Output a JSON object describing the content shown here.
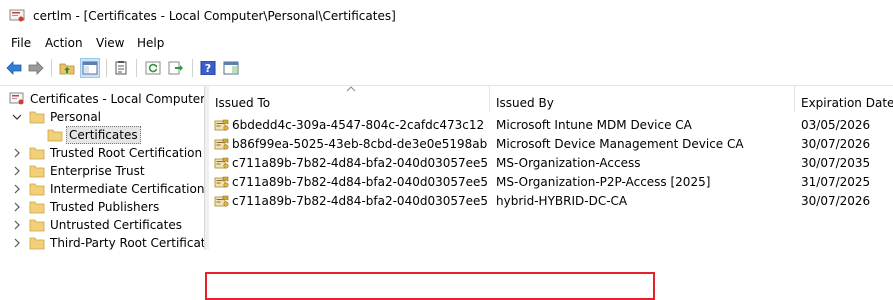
{
  "window": {
    "title": "certlm - [Certificates - Local Computer\\Personal\\Certificates]"
  },
  "menu": {
    "items": [
      "File",
      "Action",
      "View",
      "Help"
    ]
  },
  "toolbar": {
    "buttons": [
      "back-arrow-icon",
      "forward-arrow-icon",
      "up-folder-icon",
      "show-hide-console-tree-icon",
      "properties-icon",
      "refresh-icon",
      "export-list-icon",
      "help-icon",
      "action-pane-icon"
    ]
  },
  "tree": {
    "items": [
      {
        "label": "Certificates - Local Computer",
        "level": 0,
        "expanded": true
      },
      {
        "label": "Personal",
        "level": 1,
        "expanded": true
      },
      {
        "label": "Certificates",
        "level": 2,
        "selected": true
      },
      {
        "label": "Trusted Root Certification Au",
        "level": 1,
        "expanded": false
      },
      {
        "label": "Enterprise Trust",
        "level": 1,
        "expanded": false
      },
      {
        "label": "Intermediate Certification Au",
        "level": 1,
        "expanded": false
      },
      {
        "label": "Trusted Publishers",
        "level": 1,
        "expanded": false
      },
      {
        "label": "Untrusted Certificates",
        "level": 1,
        "expanded": false
      },
      {
        "label": "Third-Party Root Certification",
        "level": 1,
        "expanded": false
      }
    ]
  },
  "list": {
    "columns": [
      "Issued To",
      "Issued By",
      "Expiration Date"
    ],
    "rows": [
      {
        "issued_to": "6bdedd4c-309a-4547-804c-2cafdc473c12",
        "issued_by": "Microsoft Intune MDM Device CA",
        "expiration": "03/05/2026"
      },
      {
        "issued_to": "b86f99ea-5025-43eb-8cbd-de3e0e5198ab",
        "issued_by": "Microsoft Device Management Device CA",
        "expiration": "30/07/2026"
      },
      {
        "issued_to": "c711a89b-7b82-4d84-bfa2-040d03057ee5",
        "issued_by": "MS-Organization-Access",
        "expiration": "30/07/2035"
      },
      {
        "issued_to": "c711a89b-7b82-4d84-bfa2-040d03057ee5",
        "issued_by": "MS-Organization-P2P-Access [2025]",
        "expiration": "31/07/2025"
      },
      {
        "issued_to": "c711a89b-7b82-4d84-bfa2-040d03057ee5",
        "issued_by": "hybrid-HYBRID-DC-CA",
        "expiration": "30/07/2026"
      }
    ]
  },
  "colors": {
    "highlight": "#e8202a",
    "folder": "#dcb45a",
    "selection": "#e5e5e5"
  }
}
